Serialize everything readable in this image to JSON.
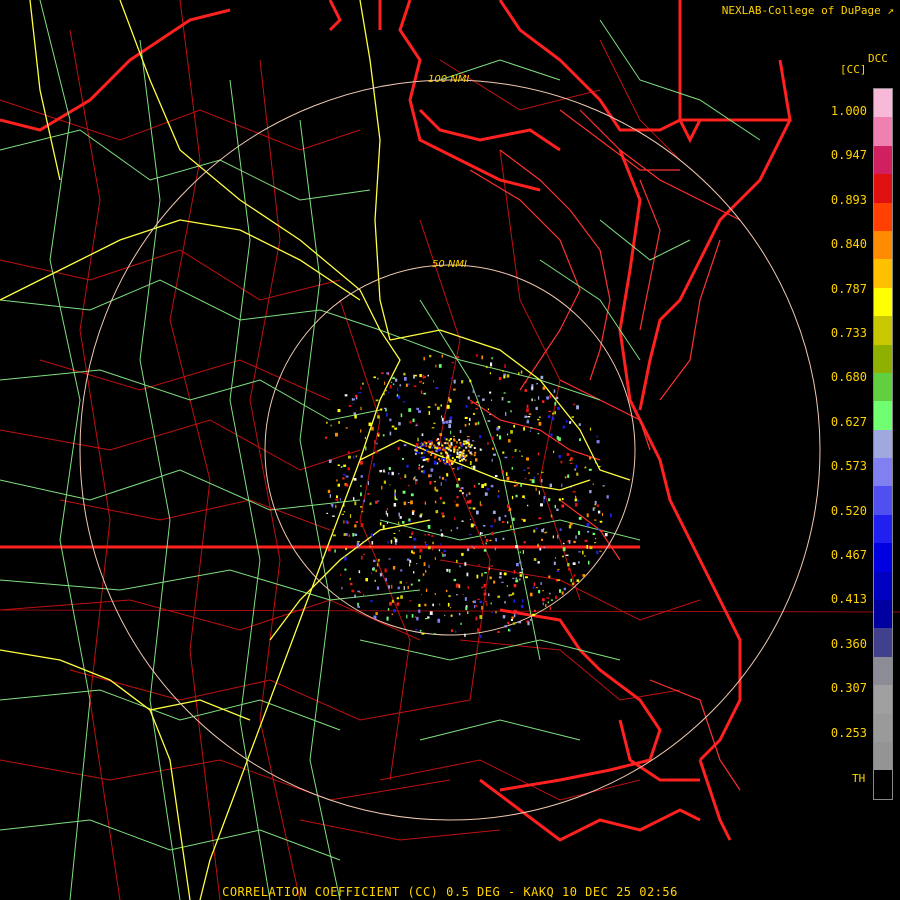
{
  "credit": "NEXLAB-College of DuPage",
  "credit_icon": "cursor-arrow-icon",
  "legend": {
    "product_code": "DCC",
    "units": "[CC]",
    "ticks": [
      "1.000",
      "0.947",
      "0.893",
      "0.840",
      "0.787",
      "0.733",
      "0.680",
      "0.627",
      "0.573",
      "0.520",
      "0.467",
      "0.413",
      "0.360",
      "0.307",
      "0.253"
    ],
    "threshold_label": "TH",
    "colors": [
      "#f8b8d8",
      "#f080b0",
      "#d02060",
      "#e01010",
      "#ff4000",
      "#ff8c00",
      "#ffc000",
      "#ffff00",
      "#c8c800",
      "#90b000",
      "#60d040",
      "#70ff70",
      "#a0a8e0",
      "#8080f0",
      "#5050f0",
      "#2020f0",
      "#0000e0",
      "#0000c0",
      "#0000a0",
      "#40408c",
      "#8c8c96",
      "#a0a0a0",
      "#9a9a9a",
      "#949494",
      "#000000"
    ]
  },
  "range_rings": [
    "100 NMI",
    "50 NMI"
  ],
  "footer": "CORRELATION COEFFICIENT (CC) 0.5 DEG - KAKQ 10 DEC 25 02:56",
  "colors": {
    "state_border": "#ff2020",
    "county_border": "#c01010",
    "highway_interstate": "#ffff40",
    "highway_other": "#7fe07f",
    "range_ring": "#f0c8b0",
    "label": "#ffd400"
  }
}
